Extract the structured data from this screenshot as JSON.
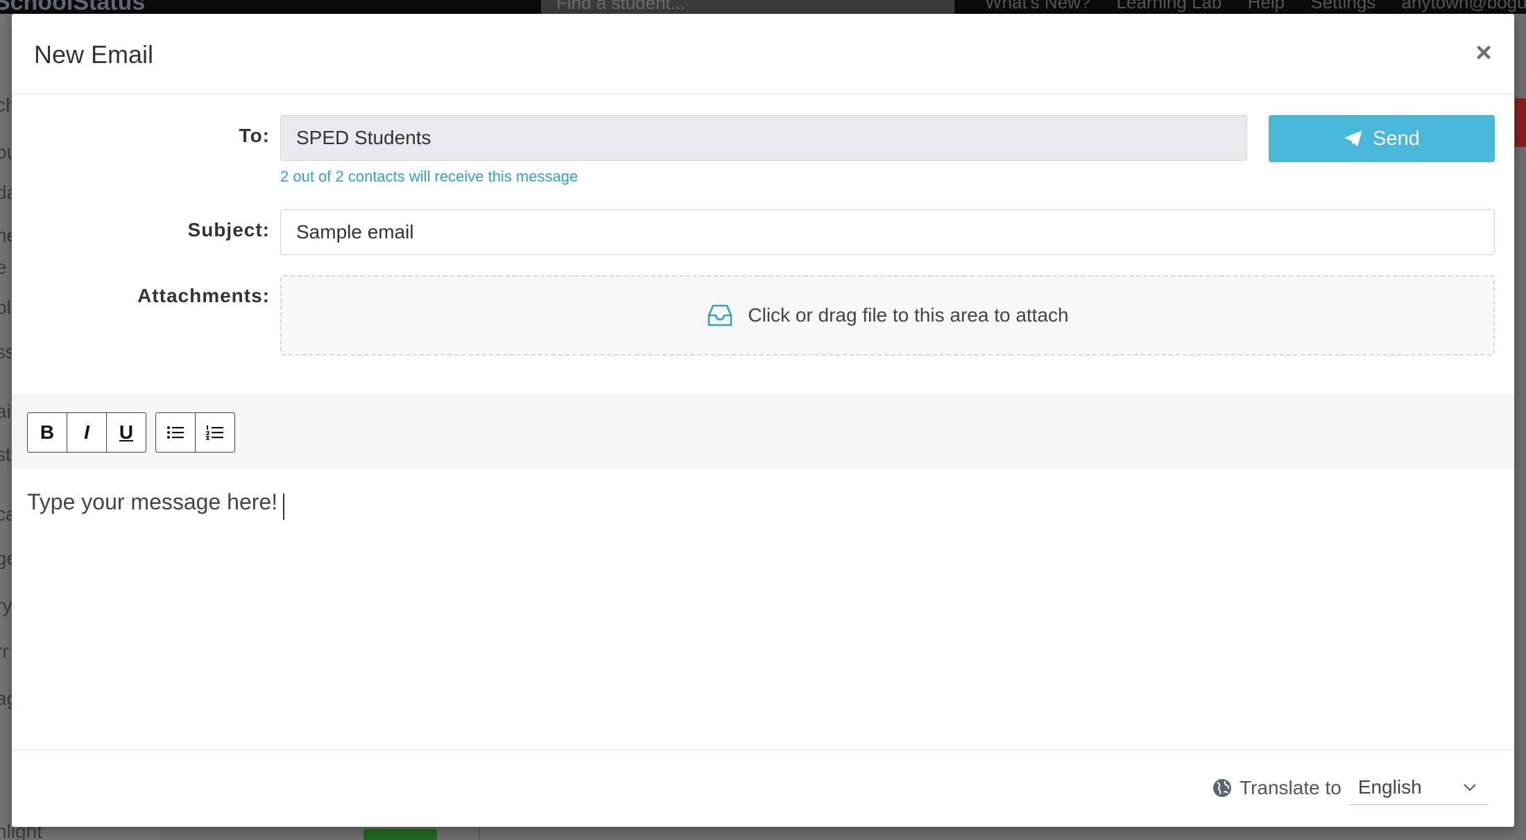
{
  "background": {
    "app_name": "SchoolStatus",
    "search_placeholder": "Find a student...",
    "nav": [
      "What's New?",
      "Learning Lab",
      "Help",
      "Settings",
      "anytown@bogu"
    ],
    "sidebar_fragments": [
      "ch",
      "ou",
      "da",
      "ne",
      "e",
      "oli",
      "ss",
      "ail",
      "st",
      "ca",
      "ge",
      "ry",
      "rr",
      "ag",
      "hlight"
    ]
  },
  "modal": {
    "title": "New Email",
    "close_symbol": "×",
    "to_label": "To:",
    "to_value": "SPED Students",
    "recipients_note": "2 out of 2 contacts will receive this message",
    "send_label": "Send",
    "subject_label": "Subject:",
    "subject_value": "Sample email",
    "attachments_label": "Attachments:",
    "dropzone_text": "Click or drag file to this area to attach",
    "editor_text": "Type your message here!",
    "toolbar": {
      "bold": "B",
      "italic": "I",
      "underline": "U"
    },
    "footer": {
      "translate_label": "Translate to",
      "language": "English"
    }
  },
  "colors": {
    "accent": "#4ab8d8",
    "link": "#2ea2c7",
    "modal_bg": "#ffffff",
    "toolbar_bg": "#f6f6f6"
  },
  "icons": {
    "send": "paper-plane-icon",
    "attach": "inbox-tray-icon",
    "translate": "globe-icon",
    "select": "chevron-down-icon"
  }
}
